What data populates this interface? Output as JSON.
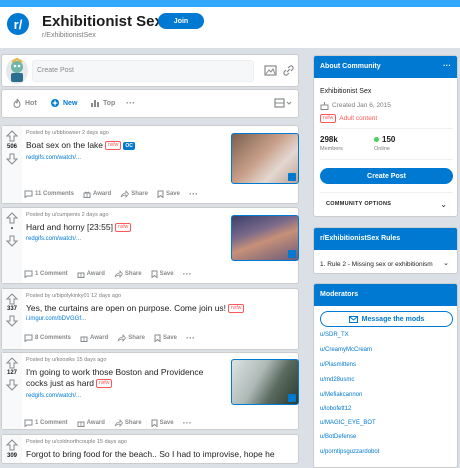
{
  "header": {
    "sub_icon_text": "r/",
    "title": "Exhibitionist Sex",
    "join_label": "Join",
    "path": "r/ExhibitionistSex"
  },
  "create_post": {
    "placeholder": "Create Post"
  },
  "sort": {
    "hot": "Hot",
    "new": "New",
    "top": "Top",
    "more": "···"
  },
  "posts": [
    {
      "score": "506",
      "meta": "Posted by u/bbbowser 2 days ago",
      "title": "Boat sex on the lake",
      "tag": "nsfw",
      "oc": "OC",
      "link": "redgifs.com/watch/...",
      "comments": "11 Comments",
      "award": "Award",
      "share": "Share",
      "save": "Save",
      "more": "···"
    },
    {
      "score": "•",
      "meta": "Posted by u/cumpenis 2 days ago",
      "title": "Hard and horny [23:55]",
      "tag": "nsfw",
      "link": "redgifs.com/watch/...",
      "comments": "1 Comment",
      "award": "Award",
      "share": "Share",
      "save": "Save",
      "more": "···"
    },
    {
      "score": "337",
      "meta": "Posted by u/bipolykinky01 12 days ago",
      "title": "Yes, the curtains are open on purpose. Come join us!",
      "tag": "nsfw",
      "link": "i.imgur.com/bDVGGf...",
      "comments": "8 Comments",
      "award": "Award",
      "share": "Share",
      "save": "Save",
      "more": "···"
    },
    {
      "score": "127",
      "meta": "Posted by u/koosiks 15 days ago",
      "title": "I'm going to work those Boston and Providence cocks just as hard",
      "tag": "nsfw",
      "link": "redgifs.com/watch/...",
      "comments": "1 Comment",
      "award": "Award",
      "share": "Share",
      "save": "Save",
      "more": "···"
    },
    {
      "score": "309",
      "meta": "Posted by u/coldnorthcouple 15 days ago",
      "title": "Forgot to bring food for the beach.. So I had to improvise, hope he"
    }
  ],
  "about": {
    "title": "About Community",
    "more": "···",
    "name": "Exhibitionist Sex",
    "created": "Created Jan 6, 2015",
    "nsfw_tag": "nsfw",
    "adult": "Adult content",
    "members": "298k",
    "members_label": "Members",
    "online": "150",
    "online_label": "Online",
    "create_post": "Create Post",
    "options": "COMMUNITY OPTIONS"
  },
  "rules": {
    "title": "r/ExhibitionistSex Rules",
    "rule1": "1. Rule 2 - Missing sex or exhibitionism"
  },
  "mods": {
    "title": "Moderators",
    "message": "Message the mods",
    "list": [
      "u/SDR_TX",
      "u/CreamyMcCream",
      "u/Plasmittens",
      "u/md28usmc",
      "u/Mefiakcannon",
      "u/lobofett12",
      "u/MAGIC_EYE_BOT",
      "u/BotDefense",
      "u/porntipsguzzardobot"
    ]
  },
  "colors": {
    "accent": "#0079d3",
    "banner": "#33a8ff",
    "nsfw": "#ff585b",
    "online": "#46d160"
  }
}
